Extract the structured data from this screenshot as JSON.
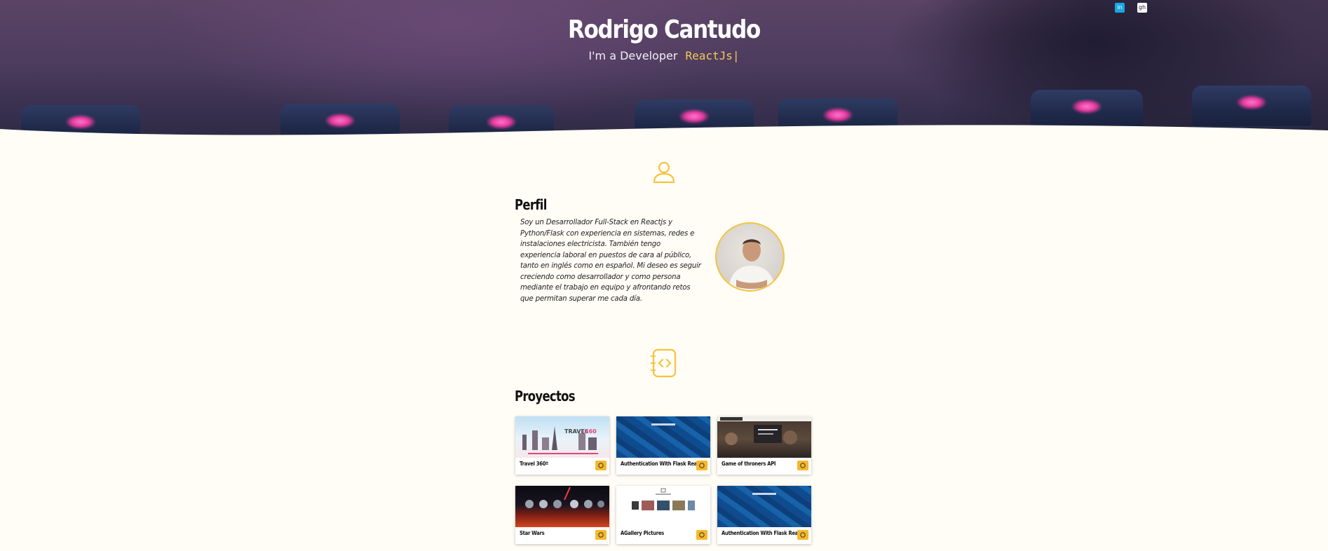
{
  "hero": {
    "name": "Rodrigo Cantudo",
    "subtitle_prefix": "I'm a Developer",
    "typed_text": "ReactJs",
    "cursor": "|"
  },
  "social": [
    {
      "name": "linkedin-icon",
      "glyph": "in"
    },
    {
      "name": "github-icon",
      "glyph": "gh"
    }
  ],
  "about": {
    "title": "Perfil",
    "icon": "user-icon",
    "text": "Soy un Desarrollador Full-Stack en Reactjs y Python/Flask con experiencia en sistemas, redes e instalaciones electricista. También tengo experiencia laboral en puestos de cara al público, tanto en inglés como en español. Mi deseo es seguir creciendo como desarrollador y como persona mediante el trabajo en equipo y afrontando retos que permitan superar me cada día."
  },
  "projects": {
    "title": "Proyectos",
    "icon": "code-notebook-icon",
    "items": [
      {
        "title": "Travel 360º",
        "thumb": "travel"
      },
      {
        "title": "Authentication With Flask React.Js",
        "thumb": "blue"
      },
      {
        "title": "Game of throners API",
        "thumb": "got"
      },
      {
        "title": "Star Wars",
        "thumb": "starwars"
      },
      {
        "title": "AGallery Pictures",
        "thumb": "gallery"
      },
      {
        "title": "Authentication With Flask React.Js",
        "thumb": "blue"
      }
    ]
  },
  "colors": {
    "accent": "#f5c342",
    "background": "#fffdf5",
    "typed": "#f5c85a"
  }
}
